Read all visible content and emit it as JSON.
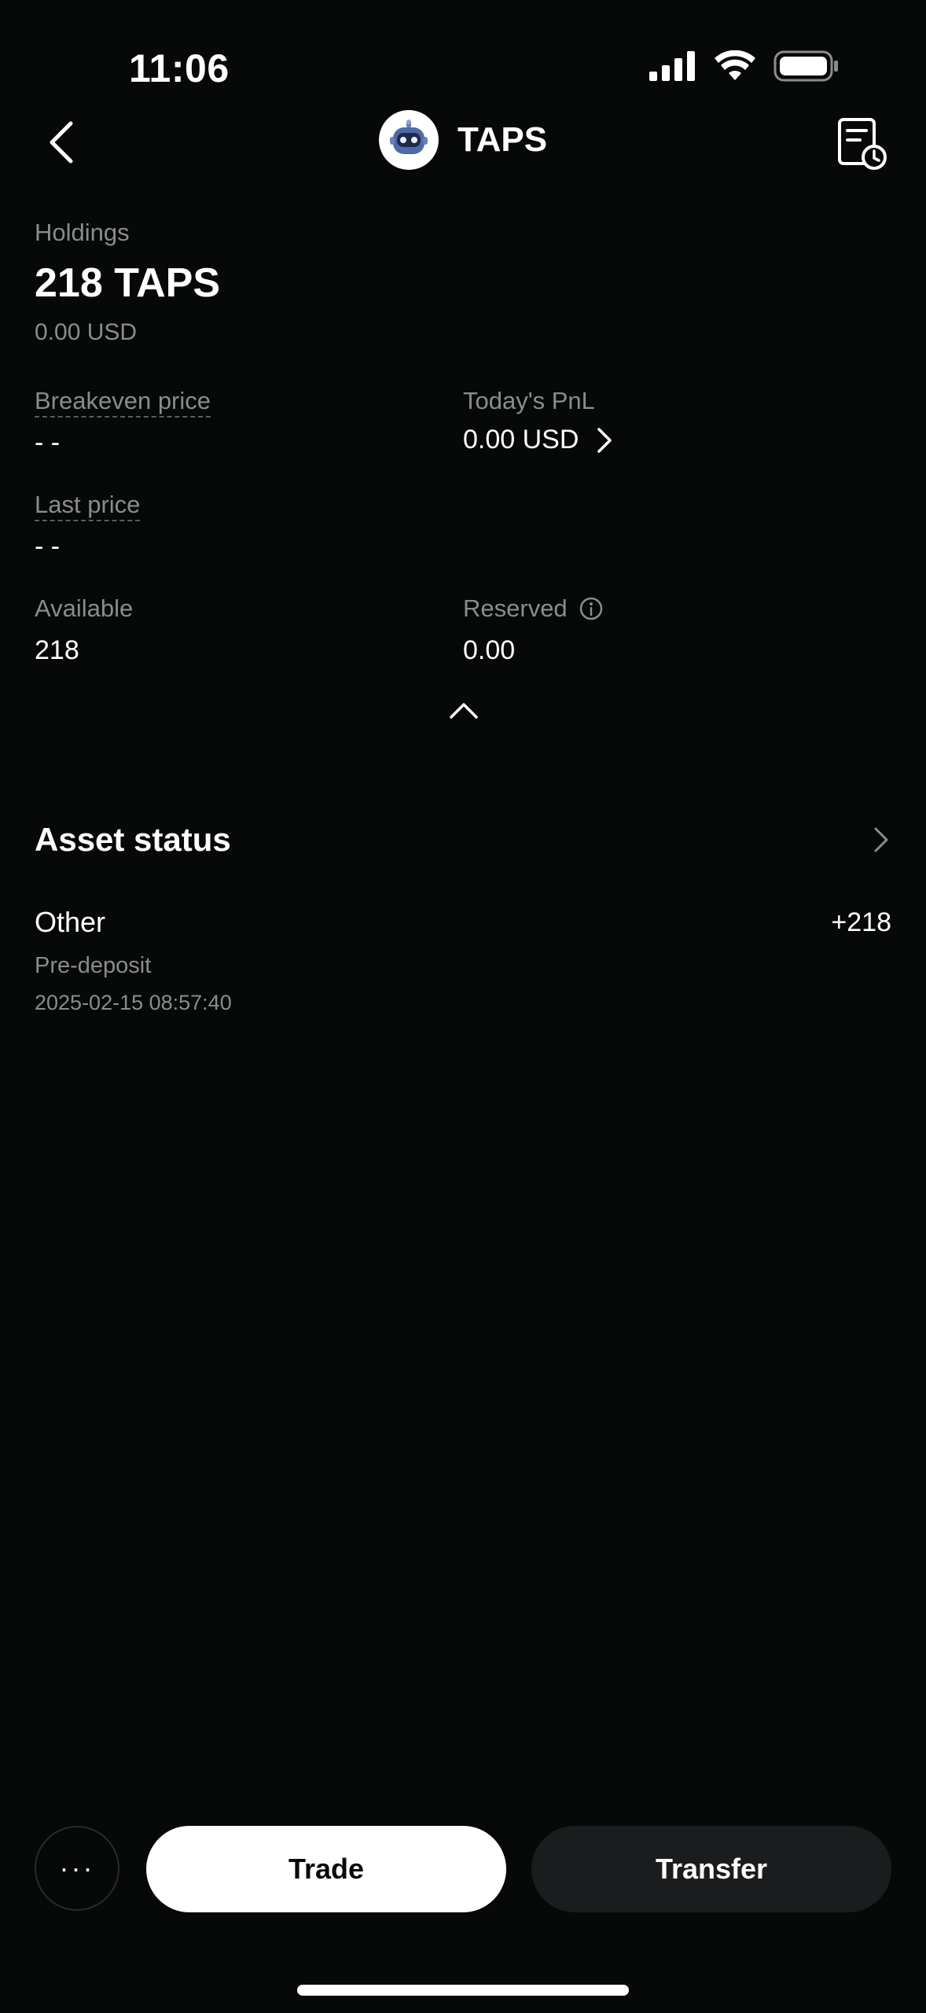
{
  "status_bar": {
    "time": "11:06",
    "icons": [
      "cellular-signal-icon",
      "wifi-icon",
      "battery-icon"
    ]
  },
  "nav": {
    "title": "TAPS",
    "back_icon": "chevron-left-icon",
    "history_icon": "history-document-icon"
  },
  "holdings": {
    "label": "Holdings",
    "amount": "218 TAPS",
    "usd_value": "0.00 USD"
  },
  "stats": {
    "breakeven_label": "Breakeven price",
    "breakeven_value": "- -",
    "pnl_label": "Today's PnL",
    "pnl_value": "0.00 USD",
    "last_price_label": "Last price",
    "last_price_value": "- -",
    "available_label": "Available",
    "available_value": "218",
    "reserved_label": "Reserved",
    "reserved_value": "0.00"
  },
  "asset_status": {
    "title": "Asset status",
    "entries": [
      {
        "type": "Other",
        "amount": "+218",
        "subtitle": "Pre-deposit",
        "date": "2025-02-15 08:57:40"
      }
    ]
  },
  "actions": {
    "more_label": "···",
    "trade_label": "Trade",
    "transfer_label": "Transfer"
  },
  "colors": {
    "background": "#070808",
    "muted_text": "#8a8c8f",
    "primary_button": "#ffffff",
    "secondary_button": "#1b1c1e"
  }
}
